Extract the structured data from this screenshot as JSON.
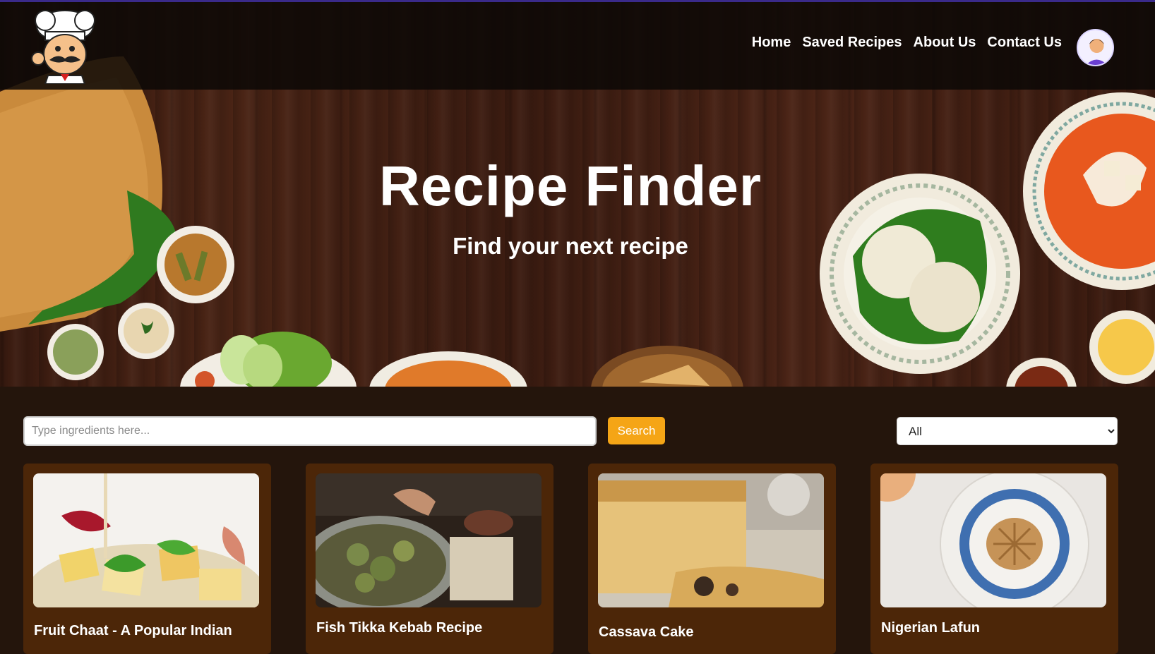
{
  "nav": {
    "logo_alt": "chef logo",
    "links": [
      "Home",
      "Saved Recipes",
      "About Us",
      "Contact Us"
    ],
    "avatar": "user-avatar"
  },
  "hero": {
    "title": "Recipe Finder",
    "subtitle": "Find your next recipe"
  },
  "search": {
    "placeholder": "Type ingredients here...",
    "value": "",
    "button_label": "Search",
    "filter_selected": "All"
  },
  "recipes": [
    {
      "title": "Fruit Chaat - A Popular Indian"
    },
    {
      "title": "Fish Tikka Kebab Recipe"
    },
    {
      "title": "Cassava Cake"
    },
    {
      "title": "Nigerian Lafun"
    }
  ],
  "colors": {
    "accent": "#f5a516",
    "card_bg": "#4c2608",
    "page_bg": "#24150c",
    "navbar_bg": "#0c0806"
  }
}
